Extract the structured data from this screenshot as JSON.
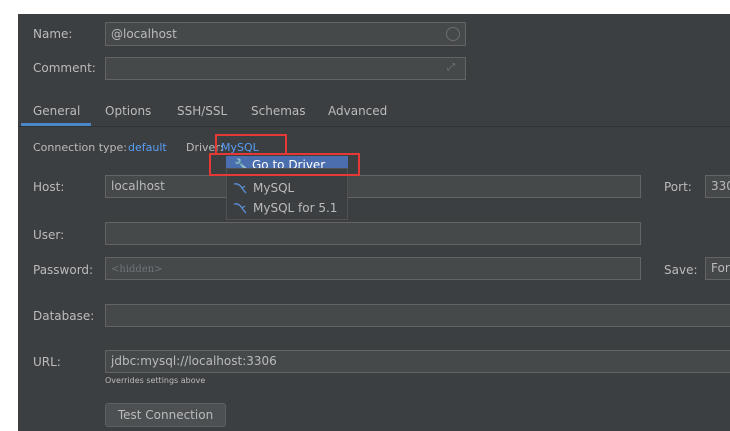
{
  "labels": {
    "name": "Name:",
    "comment": "Comment:",
    "host": "Host:",
    "port": "Port:",
    "user": "User:",
    "password": "Password:",
    "save": "Save:",
    "database": "Database:",
    "url": "URL:"
  },
  "fields": {
    "name_value": "@localhost",
    "comment_value": "",
    "host_value": "localhost",
    "port_value": "330",
    "user_value": "",
    "password_placeholder": "<hidden>",
    "save_value": "For",
    "database_value": "",
    "url_value": "jdbc:mysql://localhost:3306",
    "url_hint": "Overrides settings above"
  },
  "tabs": [
    {
      "label": "General",
      "active": true
    },
    {
      "label": "Options"
    },
    {
      "label": "SSH/SSL"
    },
    {
      "label": "Schemas"
    },
    {
      "label": "Advanced"
    }
  ],
  "connection": {
    "type_label": "Connection type:",
    "type_value": "default",
    "driver_label": "Driver:",
    "driver_value": "MySQL"
  },
  "driver_menu": {
    "items": [
      {
        "label": "Go to Driver",
        "icon": "wrench-icon",
        "selected": true
      },
      {
        "label": "MySQL",
        "icon": "dolphin-icon"
      },
      {
        "label": "MySQL for 5.1",
        "icon": "dolphin-icon"
      }
    ]
  },
  "buttons": {
    "test_connection": "Test Connection"
  },
  "colors": {
    "panel_bg": "#3c3f41",
    "accent": "#4a88c7",
    "link": "#589df6",
    "selection": "#4b6eaf",
    "highlight_box": "#e53935"
  }
}
